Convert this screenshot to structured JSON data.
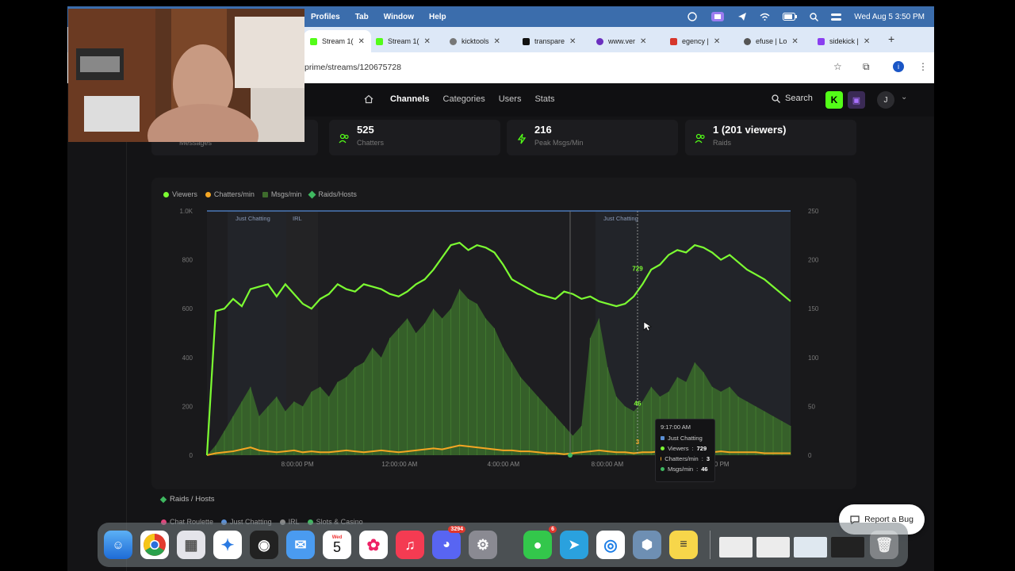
{
  "menubar": {
    "items": [
      "Profiles",
      "Tab",
      "Window",
      "Help"
    ],
    "datetime": "Wed Aug 5  3:50 PM"
  },
  "tabs": [
    {
      "label": "Stream 1(",
      "active": true,
      "color": "#53fc18"
    },
    {
      "label": "Stream 1(",
      "active": false,
      "color": "#53fc18"
    },
    {
      "label": "kicktools",
      "active": false,
      "color": "#777777"
    },
    {
      "label": "transpare",
      "active": false,
      "color": "#111111"
    },
    {
      "label": "www.ver",
      "active": false,
      "color": "#6b2fbf"
    },
    {
      "label": "egency |",
      "active": false,
      "color": "#d6362b"
    },
    {
      "label": "efuse | Lo",
      "active": false,
      "color": "#555555"
    },
    {
      "label": "sidekick |",
      "active": false,
      "color": "#8a3ff0"
    }
  ],
  "address": {
    "url": "prime/streams/120675728"
  },
  "nav": {
    "links": [
      "Channels",
      "Categories",
      "Users",
      "Stats"
    ],
    "active": "Channels",
    "search_label": "Search",
    "avatar_initial": "J"
  },
  "stats": [
    {
      "value": "",
      "label": "Messages",
      "icon": "chat-icon"
    },
    {
      "value": "525",
      "label": "Chatters",
      "icon": "users-icon"
    },
    {
      "value": "216",
      "label": "Peak Msgs/Min",
      "icon": "bolt-icon"
    },
    {
      "value": "1 (201 viewers)",
      "label": "Raids",
      "icon": "users-icon"
    }
  ],
  "chart_data": {
    "type": "line",
    "legend": [
      {
        "name": "Viewers",
        "color": "#7cfc32"
      },
      {
        "name": "Chatters/min",
        "color": "#f5a623"
      },
      {
        "name": "Msgs/min",
        "color": "#3e6b2c"
      },
      {
        "name": "Raids/Hosts",
        "color": "#3fb860"
      }
    ],
    "x_ticks": [
      "8:00:00 PM",
      "12:00:00 AM",
      "4:00:00 AM",
      "8:00:00 AM",
      "12:00:00 PM"
    ],
    "y_left_ticks": [
      "0",
      "200",
      "400",
      "600",
      "800",
      "1.0K"
    ],
    "y_right_ticks": [
      "0",
      "50",
      "100",
      "150",
      "200",
      "250"
    ],
    "ylim_left": [
      0,
      1000
    ],
    "ylim_right": [
      0,
      250
    ],
    "category_bands": [
      {
        "label": "Just Chatting",
        "color": "#3a4f6e"
      },
      {
        "label": "IRL",
        "color": "#3a3a3a"
      },
      {
        "label": "Just Chatting",
        "color": "#3a4f6e"
      }
    ],
    "series": [
      {
        "name": "Viewers",
        "values": [
          0,
          590,
          600,
          640,
          610,
          680,
          690,
          700,
          650,
          700,
          660,
          620,
          600,
          640,
          660,
          700,
          680,
          670,
          700,
          690,
          680,
          660,
          650,
          670,
          700,
          720,
          760,
          810,
          860,
          870,
          840,
          860,
          850,
          830,
          780,
          720,
          700,
          680,
          660,
          650,
          640,
          670,
          660,
          640,
          650,
          630,
          620,
          610,
          620,
          650,
          700,
          760,
          780,
          820,
          840,
          830,
          860,
          850,
          830,
          800,
          820,
          790,
          760,
          740,
          720,
          690,
          660,
          630
        ]
      },
      {
        "name": "Msgs/min",
        "values": [
          0,
          10,
          25,
          40,
          55,
          70,
          40,
          50,
          60,
          45,
          55,
          50,
          65,
          70,
          60,
          75,
          80,
          90,
          95,
          110,
          100,
          120,
          130,
          140,
          125,
          135,
          150,
          140,
          150,
          170,
          160,
          155,
          140,
          130,
          110,
          95,
          80,
          70,
          60,
          50,
          40,
          30,
          20,
          30,
          120,
          140,
          90,
          60,
          50,
          45,
          55,
          70,
          60,
          65,
          80,
          75,
          95,
          85,
          70,
          65,
          70,
          60,
          55,
          50,
          45,
          40,
          35,
          30
        ]
      },
      {
        "name": "Chatters/min",
        "values": [
          0,
          2,
          3,
          4,
          6,
          8,
          5,
          4,
          3,
          4,
          5,
          3,
          4,
          3,
          3,
          4,
          5,
          4,
          3,
          4,
          5,
          4,
          3,
          4,
          5,
          6,
          7,
          6,
          8,
          10,
          9,
          8,
          7,
          6,
          5,
          5,
          4,
          4,
          3,
          2,
          2,
          1,
          2,
          3,
          4,
          5,
          4,
          3,
          3,
          2,
          3,
          3,
          4,
          3,
          3,
          4,
          4,
          3,
          3,
          4,
          3,
          3,
          3,
          3,
          2,
          2,
          2,
          2
        ]
      }
    ],
    "point_labels": [
      "729",
      "46",
      "3"
    ],
    "tooltip": {
      "time": "9:17:00 AM",
      "category": "Just Chatting",
      "rows": [
        {
          "name": "Viewers",
          "value": "729",
          "color": "#7cfc32"
        },
        {
          "name": "Chatters/min",
          "value": "3",
          "color": "#f5a623"
        },
        {
          "name": "Msgs/min",
          "value": "46",
          "color": "#3fb860"
        }
      ]
    }
  },
  "raids_section": {
    "title": "Raids / Hosts"
  },
  "category_legend": [
    {
      "name": "Chat Roulette",
      "color": "#e0447a"
    },
    {
      "name": "Just Chatting",
      "color": "#5a8fd6"
    },
    {
      "name": "IRL",
      "color": "#888888"
    },
    {
      "name": "Slots & Casino",
      "color": "#3fb860"
    }
  ],
  "report_bug": {
    "label": "Report a Bug"
  },
  "dock": {
    "calendar_month": "Wed",
    "calendar_day": "5",
    "discord_badge": "3294",
    "messages_badge": "6"
  }
}
